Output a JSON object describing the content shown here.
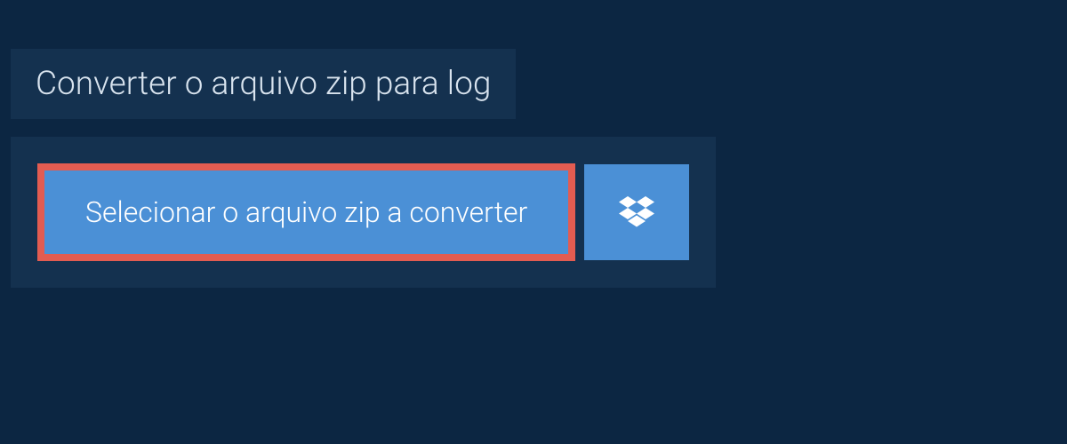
{
  "title": "Converter o arquivo zip para log",
  "buttons": {
    "select_file": "Selecionar o arquivo zip a converter"
  }
}
